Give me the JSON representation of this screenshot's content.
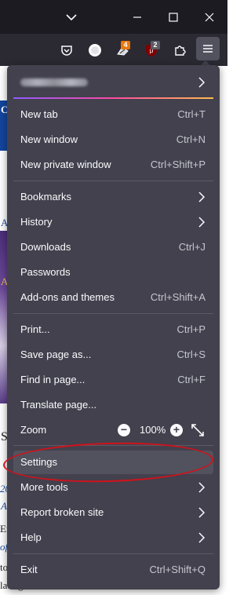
{
  "toolbar": {
    "badge_counts": [
      "4",
      "2"
    ],
    "colors": {
      "badge_orange": "#e8790e",
      "badge_gray": "#5b5b66",
      "ublock_red": "#800000"
    }
  },
  "menu": {
    "account_label": "",
    "items": [
      {
        "label": "New tab",
        "shortcut": "Ctrl+T"
      },
      {
        "label": "New window",
        "shortcut": "Ctrl+N"
      },
      {
        "label": "New private window",
        "shortcut": "Ctrl+Shift+P"
      },
      {
        "label": "Bookmarks",
        "shortcut": ""
      },
      {
        "label": "History",
        "shortcut": ""
      },
      {
        "label": "Downloads",
        "shortcut": "Ctrl+J"
      },
      {
        "label": "Passwords",
        "shortcut": ""
      },
      {
        "label": "Add-ons and themes",
        "shortcut": "Ctrl+Shift+A"
      },
      {
        "label": "Print...",
        "shortcut": "Ctrl+P"
      },
      {
        "label": "Save page as...",
        "shortcut": "Ctrl+S"
      },
      {
        "label": "Find in page...",
        "shortcut": "Ctrl+F"
      },
      {
        "label": "Translate page...",
        "shortcut": ""
      },
      {
        "label": "Settings",
        "shortcut": ""
      },
      {
        "label": "More tools",
        "shortcut": ""
      },
      {
        "label": "Report broken site",
        "shortcut": ""
      },
      {
        "label": "Help",
        "shortcut": ""
      },
      {
        "label": "Exit",
        "shortcut": "Ctrl+Shift+Q"
      }
    ],
    "zoom": {
      "label": "Zoom",
      "minus": "−",
      "value": "100%",
      "plus": "+"
    }
  },
  "background_page": {
    "fragments": [
      "C",
      "A",
      "A",
      "S",
      "20",
      "A",
      "Er",
      "of",
      "to",
      "lating between three distinct"
    ]
  }
}
